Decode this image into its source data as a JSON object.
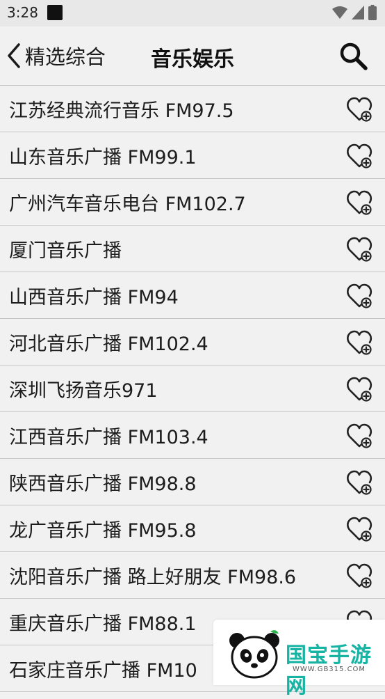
{
  "status_bar": {
    "time": "3:28"
  },
  "header": {
    "back_label": "精选综合",
    "title": "音乐娱乐"
  },
  "stations": [
    "江苏经典流行音乐 FM97.5",
    "山东音乐广播 FM99.1",
    "广州汽车音乐电台 FM102.7",
    "厦门音乐广播",
    "山西音乐广播 FM94",
    "河北音乐广播 FM102.4",
    "深圳飞扬音乐971",
    "江西音乐广播 FM103.4",
    "陕西音乐广播 FM98.8",
    "龙广音乐广播 FM95.8",
    "沈阳音乐广播 路上好朋友 FM98.6",
    "重庆音乐广播 FM88.1",
    "石家庄音乐广播 FM10"
  ],
  "watermark": {
    "brand": "国宝手游网",
    "url": "WWW.GB315.COM"
  },
  "colors": {
    "background": "#f1f1f1",
    "divider": "#c6c6c6",
    "watermark_brand": "#17b3a3"
  },
  "icons": {
    "back": "chevron-left-icon",
    "search": "search-icon",
    "favorite": "heart-plus-icon"
  }
}
